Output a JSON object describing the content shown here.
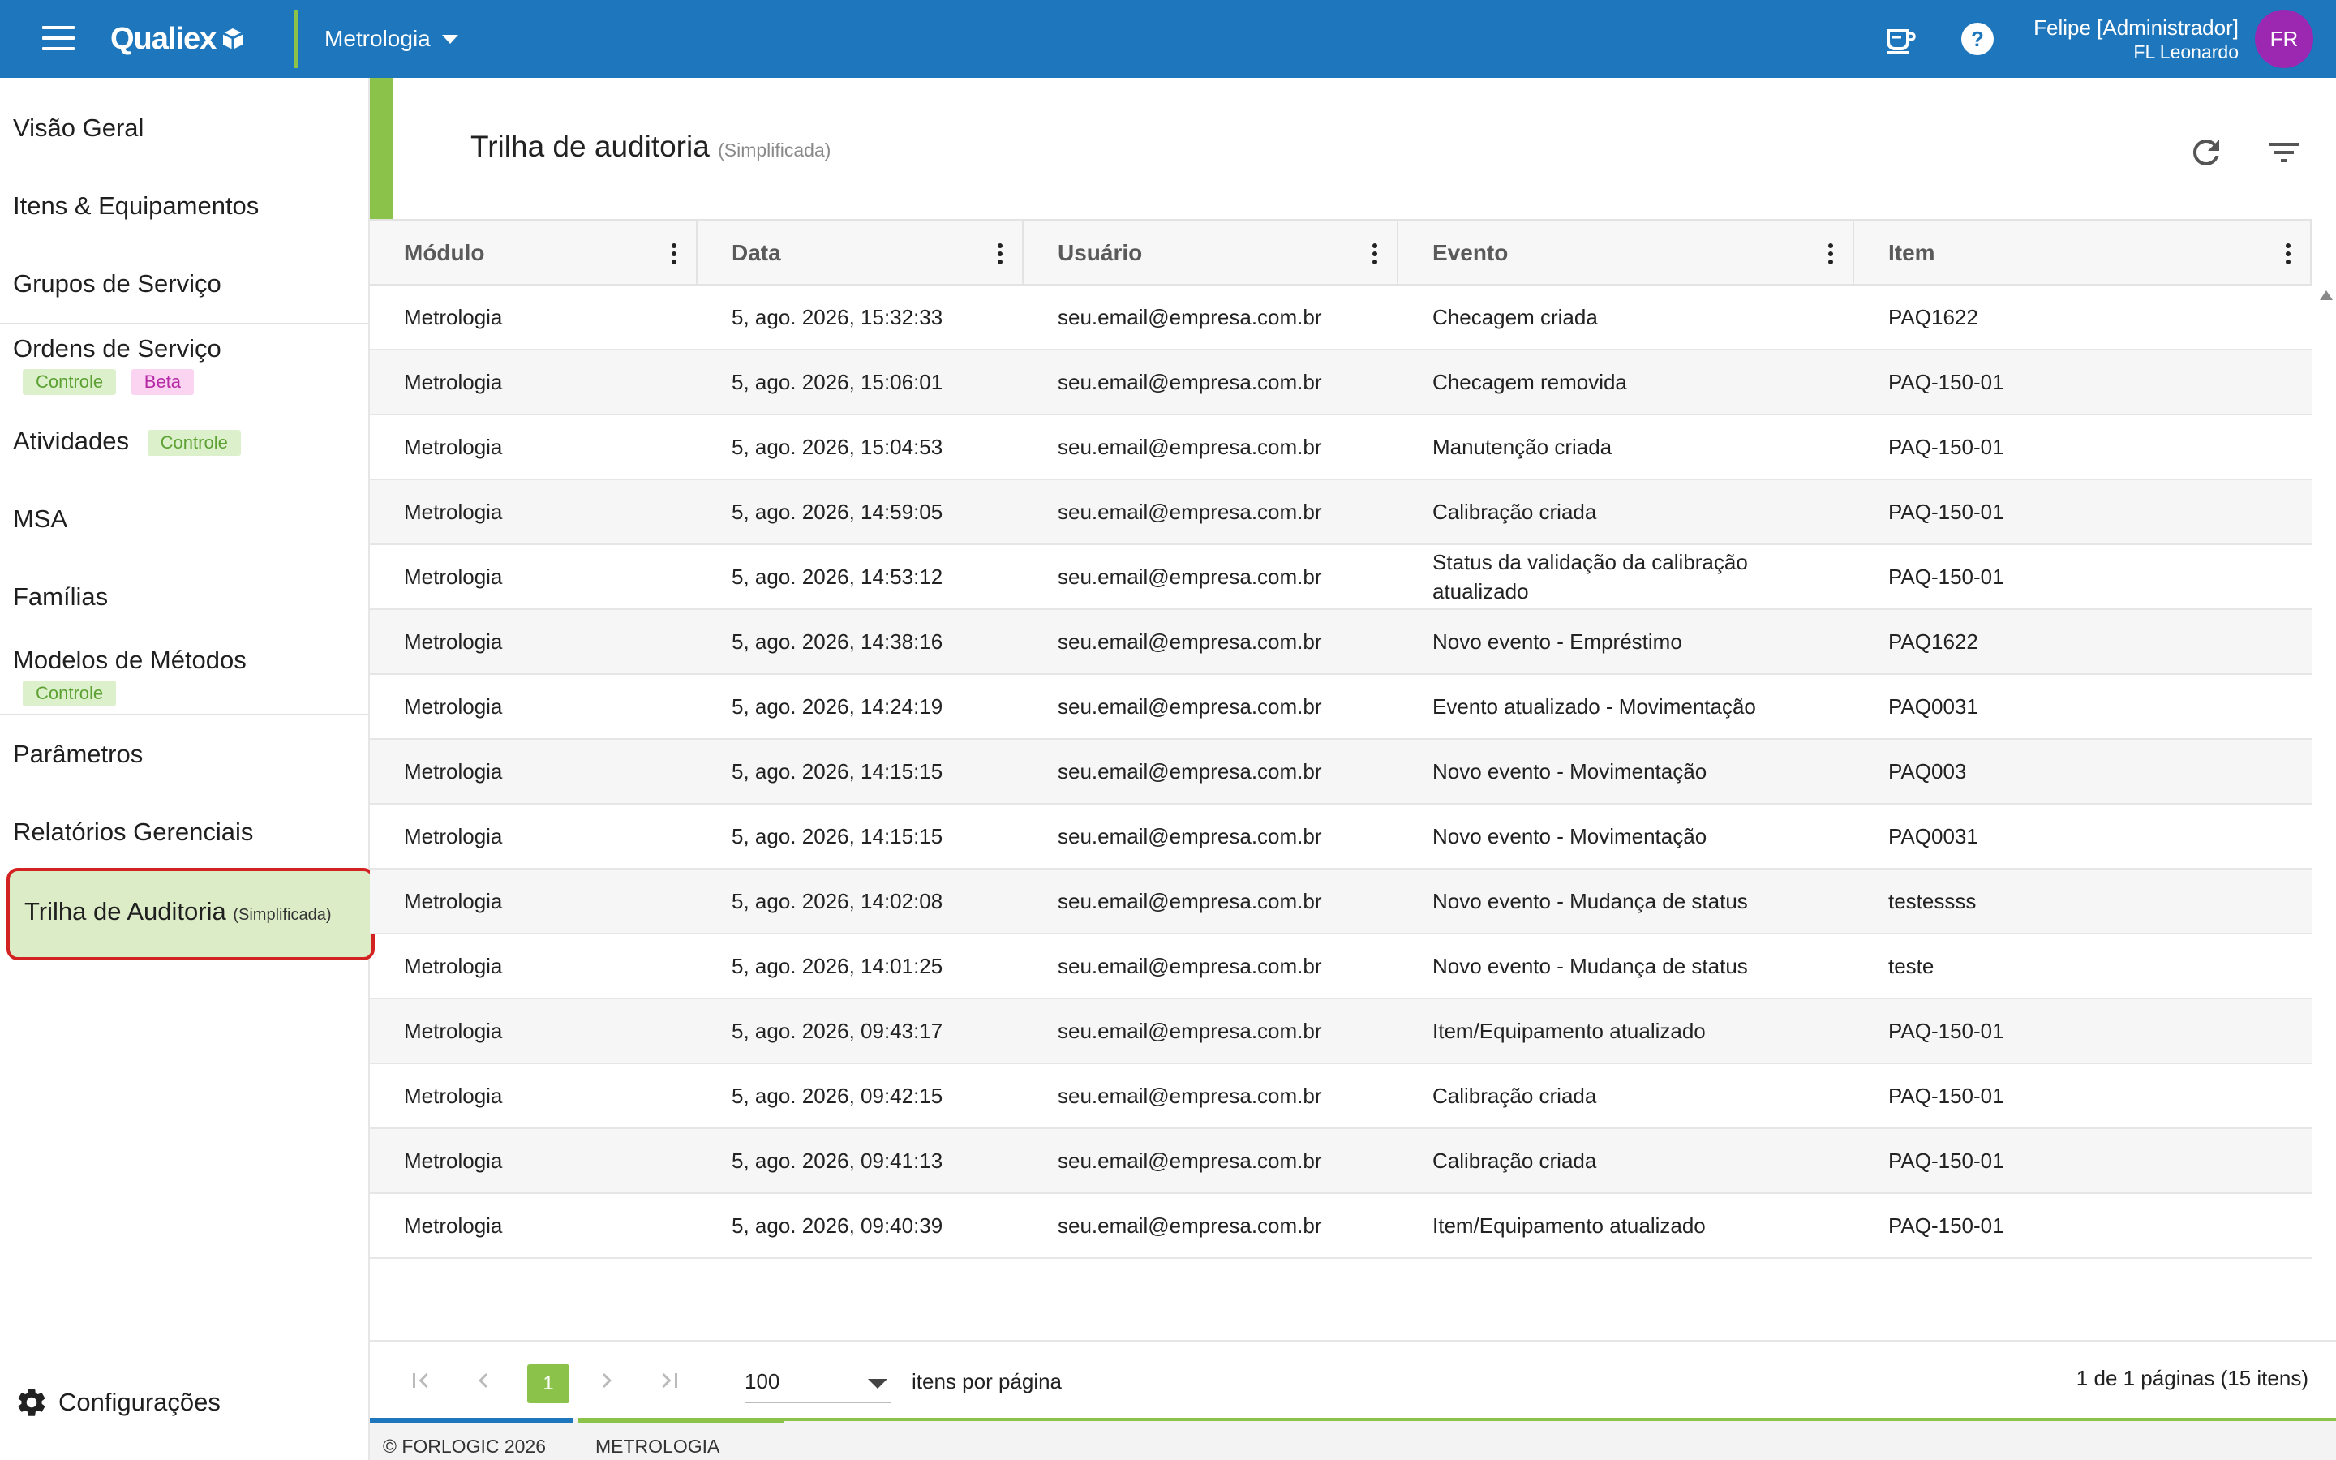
{
  "topbar": {
    "app_name": "Qualiex",
    "module": "Metrologia",
    "user_name": "Felipe [Administrador]",
    "user_sub": "FL Leonardo",
    "avatar_initials": "FR",
    "brand_color": "#1e77bd",
    "accent_color": "#8bc34a",
    "avatar_color": "#9c27b0"
  },
  "sidebar": {
    "items": [
      {
        "label": "Visão Geral"
      },
      {
        "label": "Itens & Equipamentos"
      },
      {
        "label": "Grupos de Serviço"
      },
      {
        "label": "Ordens de Serviço",
        "badges": [
          "Controle",
          "Beta"
        ]
      },
      {
        "label": "Atividades",
        "badges": [
          "Controle"
        ]
      },
      {
        "label": "MSA"
      },
      {
        "label": "Famílias"
      },
      {
        "label": "Modelos de Métodos",
        "badges": [
          "Controle"
        ]
      },
      {
        "label": "Parâmetros"
      },
      {
        "label": "Relatórios Gerenciais"
      },
      {
        "label": "Trilha de Auditoria",
        "sub": "(Simplificada)",
        "active": true
      }
    ],
    "settings_label": "Configurações"
  },
  "page": {
    "title": "Trilha de auditoria",
    "subtitle": "(Simplificada)"
  },
  "table": {
    "columns": [
      "Módulo",
      "Data",
      "Usuário",
      "Evento",
      "Item"
    ],
    "rows": [
      [
        "Metrologia",
        "5, ago. 2026, 15:32:33",
        "seu.email@empresa.com.br",
        "Checagem criada",
        "PAQ1622"
      ],
      [
        "Metrologia",
        "5, ago. 2026, 15:06:01",
        "seu.email@empresa.com.br",
        "Checagem removida",
        "PAQ-150-01"
      ],
      [
        "Metrologia",
        "5, ago. 2026, 15:04:53",
        "seu.email@empresa.com.br",
        "Manutenção criada",
        "PAQ-150-01"
      ],
      [
        "Metrologia",
        "5, ago. 2026, 14:59:05",
        "seu.email@empresa.com.br",
        "Calibração criada",
        "PAQ-150-01"
      ],
      [
        "Metrologia",
        "5, ago. 2026, 14:53:12",
        "seu.email@empresa.com.br",
        "Status da validação da calibração atualizado",
        "PAQ-150-01"
      ],
      [
        "Metrologia",
        "5, ago. 2026, 14:38:16",
        "seu.email@empresa.com.br",
        "Novo evento - Empréstimo",
        "PAQ1622"
      ],
      [
        "Metrologia",
        "5, ago. 2026, 14:24:19",
        "seu.email@empresa.com.br",
        "Evento atualizado - Movimentação",
        "PAQ0031"
      ],
      [
        "Metrologia",
        "5, ago. 2026, 14:15:15",
        "seu.email@empresa.com.br",
        "Novo evento - Movimentação",
        "PAQ003"
      ],
      [
        "Metrologia",
        "5, ago. 2026, 14:15:15",
        "seu.email@empresa.com.br",
        "Novo evento - Movimentação",
        "PAQ0031"
      ],
      [
        "Metrologia",
        "5, ago. 2026, 14:02:08",
        "seu.email@empresa.com.br",
        "Novo evento - Mudança de status",
        "testessss"
      ],
      [
        "Metrologia",
        "5, ago. 2026, 14:01:25",
        "seu.email@empresa.com.br",
        "Novo evento - Mudança de status",
        "teste"
      ],
      [
        "Metrologia",
        "5, ago. 2026, 09:43:17",
        "seu.email@empresa.com.br",
        "Item/Equipamento atualizado",
        "PAQ-150-01"
      ],
      [
        "Metrologia",
        "5, ago. 2026, 09:42:15",
        "seu.email@empresa.com.br",
        "Calibração criada",
        "PAQ-150-01"
      ],
      [
        "Metrologia",
        "5, ago. 2026, 09:41:13",
        "seu.email@empresa.com.br",
        "Calibração criada",
        "PAQ-150-01"
      ],
      [
        "Metrologia",
        "5, ago. 2026, 09:40:39",
        "seu.email@empresa.com.br",
        "Item/Equipamento atualizado",
        "PAQ-150-01"
      ]
    ]
  },
  "pagination": {
    "current_page": "1",
    "page_size": "100",
    "page_size_label": "itens por página",
    "info": "1 de 1 páginas (15 itens)"
  },
  "footer": {
    "copyright": "© FORLOGIC 2026",
    "module": "METROLOGIA"
  }
}
